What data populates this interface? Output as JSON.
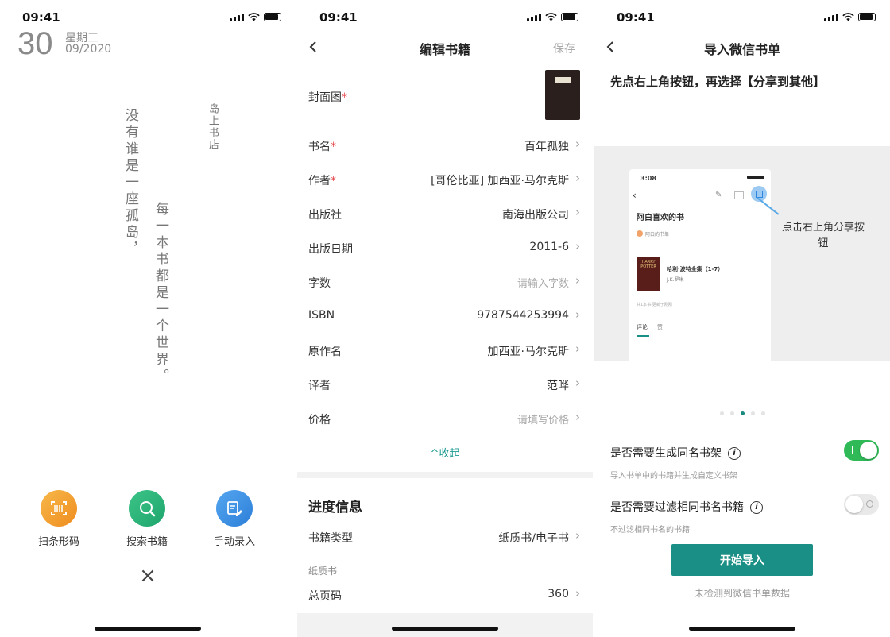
{
  "status_time": "09:41",
  "phone1": {
    "date_day": "30",
    "date_weekday": "星期三",
    "date_monthyear": "09/2020",
    "poem_col1": "没有谁是一座孤岛，",
    "poem_col2": "每一本书都是一个世界。",
    "app_name": "岛上书店",
    "actions": [
      {
        "label": "扫条形码",
        "icon": "barcode-scan-icon",
        "color": "#f4a52a"
      },
      {
        "label": "搜索书籍",
        "icon": "search-icon",
        "color": "#2db37a"
      },
      {
        "label": "手动录入",
        "icon": "edit-entry-icon",
        "color": "#3a8fe0"
      }
    ],
    "close_glyph": "×"
  },
  "phone2": {
    "title": "编辑书籍",
    "save": "保存",
    "fields": [
      {
        "key": "封面图",
        "required": true
      },
      {
        "key": "书名",
        "required": true,
        "value": "百年孤独"
      },
      {
        "key": "作者",
        "required": true,
        "value": "[哥伦比亚] 加西亚·马尔克斯"
      },
      {
        "key": "出版社",
        "value": "南海出版公司"
      },
      {
        "key": "出版日期",
        "value": "2011-6"
      },
      {
        "key": "字数",
        "placeholder": "请输入字数"
      },
      {
        "key": "ISBN",
        "value": "9787544253994"
      },
      {
        "key": "原作名",
        "value": "加西亚·马尔克斯"
      },
      {
        "key": "译者",
        "value": "范晔"
      },
      {
        "key": "价格",
        "placeholder": "请填写价格"
      }
    ],
    "collapse": "^收起",
    "progress_title": "进度信息",
    "book_type_key": "书籍类型",
    "book_type_value": "纸质书/电子书",
    "paper_label": "纸质书",
    "total_pages_key": "总页码",
    "total_pages_value": "360"
  },
  "phone3": {
    "title": "导入微信书单",
    "instruction": "先点右上角按钮，再选择【分享到其他】",
    "mini": {
      "time": "3:08",
      "list_title": "阿白喜欢的书",
      "owner": "阿白的书单",
      "book_title": "哈利·波特全集（1-7）",
      "book_author": "J.K.罗琳",
      "summary": "共1本书·更新于刚刚",
      "tab_comments": "评论",
      "tab_likes": "赞",
      "cover_text": "HARRY POTTER"
    },
    "callout": "点击右上角分享按钮",
    "option1_title": "是否需要生成同名书架",
    "option1_desc": "导入书单中的书籍并生成自定义书架",
    "option1_on": true,
    "option2_title": "是否需要过滤相同书名书籍",
    "option2_desc": "不过滤相同书名的书籍",
    "option2_on": false,
    "start_button": "开始导入",
    "nodata": "未检测到微信书单数据",
    "accent": "#1a8f85"
  }
}
